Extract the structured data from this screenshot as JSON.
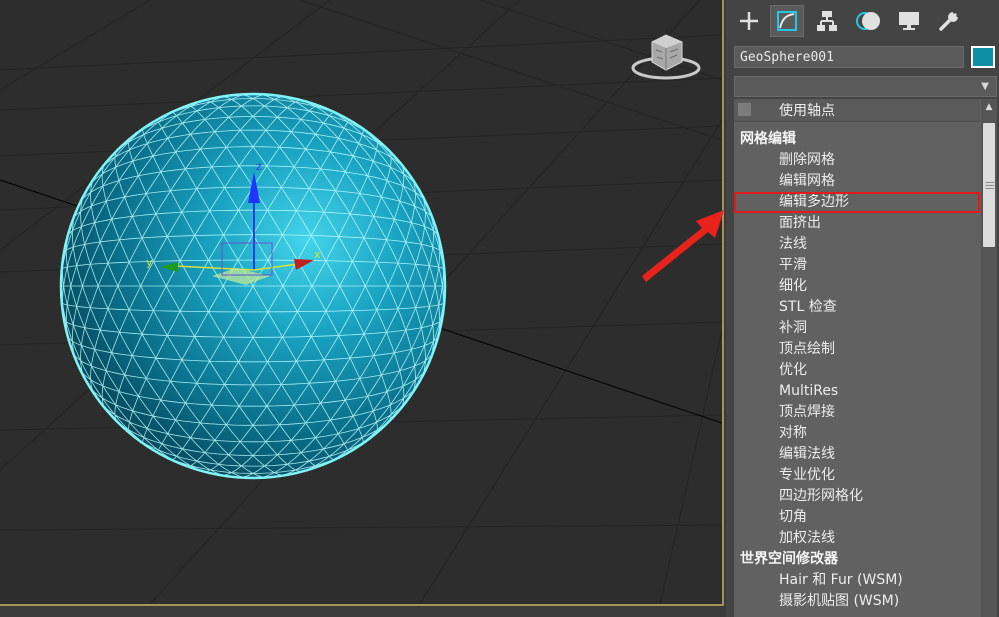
{
  "viewport": {
    "axis_labels": {
      "x": "x",
      "y": "y",
      "z": "z"
    }
  },
  "command_panel": {
    "tabs": [
      {
        "name": "create",
        "icon": "plus-icon"
      },
      {
        "name": "modify",
        "icon": "modify-curve-icon",
        "active": true
      },
      {
        "name": "hierarchy",
        "icon": "hierarchy-icon"
      },
      {
        "name": "motion",
        "icon": "motion-icon"
      },
      {
        "name": "display",
        "icon": "monitor-icon"
      },
      {
        "name": "utilities",
        "icon": "wrench-icon"
      }
    ],
    "object_name": "GeoSphere001",
    "object_color": "#0e8fa8",
    "modifier_dropdown_value": "",
    "pivot_checkbox_label": "使用轴点",
    "modifier_list": [
      {
        "type": "category",
        "label": "网格编辑"
      },
      {
        "type": "item",
        "label": "删除网格"
      },
      {
        "type": "item",
        "label": "编辑网格"
      },
      {
        "type": "item",
        "label": "编辑多边形",
        "highlighted": true
      },
      {
        "type": "item",
        "label": "面挤出"
      },
      {
        "type": "item",
        "label": "法线"
      },
      {
        "type": "item",
        "label": "平滑"
      },
      {
        "type": "item",
        "label": "细化"
      },
      {
        "type": "item",
        "label": "STL 检查"
      },
      {
        "type": "item",
        "label": "补洞"
      },
      {
        "type": "item",
        "label": "顶点绘制"
      },
      {
        "type": "item",
        "label": "优化"
      },
      {
        "type": "item",
        "label": "MultiRes"
      },
      {
        "type": "item",
        "label": "顶点焊接"
      },
      {
        "type": "item",
        "label": "对称"
      },
      {
        "type": "item",
        "label": "编辑法线"
      },
      {
        "type": "item",
        "label": "专业优化"
      },
      {
        "type": "item",
        "label": "四边形网格化"
      },
      {
        "type": "item",
        "label": "切角"
      },
      {
        "type": "item",
        "label": "加权法线"
      },
      {
        "type": "category",
        "label": "世界空间修改器"
      },
      {
        "type": "item",
        "label": "Hair 和 Fur (WSM)"
      },
      {
        "type": "item",
        "label": "摄影机贴图 (WSM)"
      }
    ]
  },
  "colors": {
    "selection_highlight": "#e31b1b",
    "sphere_wire": "#7ff3f7",
    "panel_bg": "#444444",
    "viewport_bg": "#2d2d2d"
  }
}
